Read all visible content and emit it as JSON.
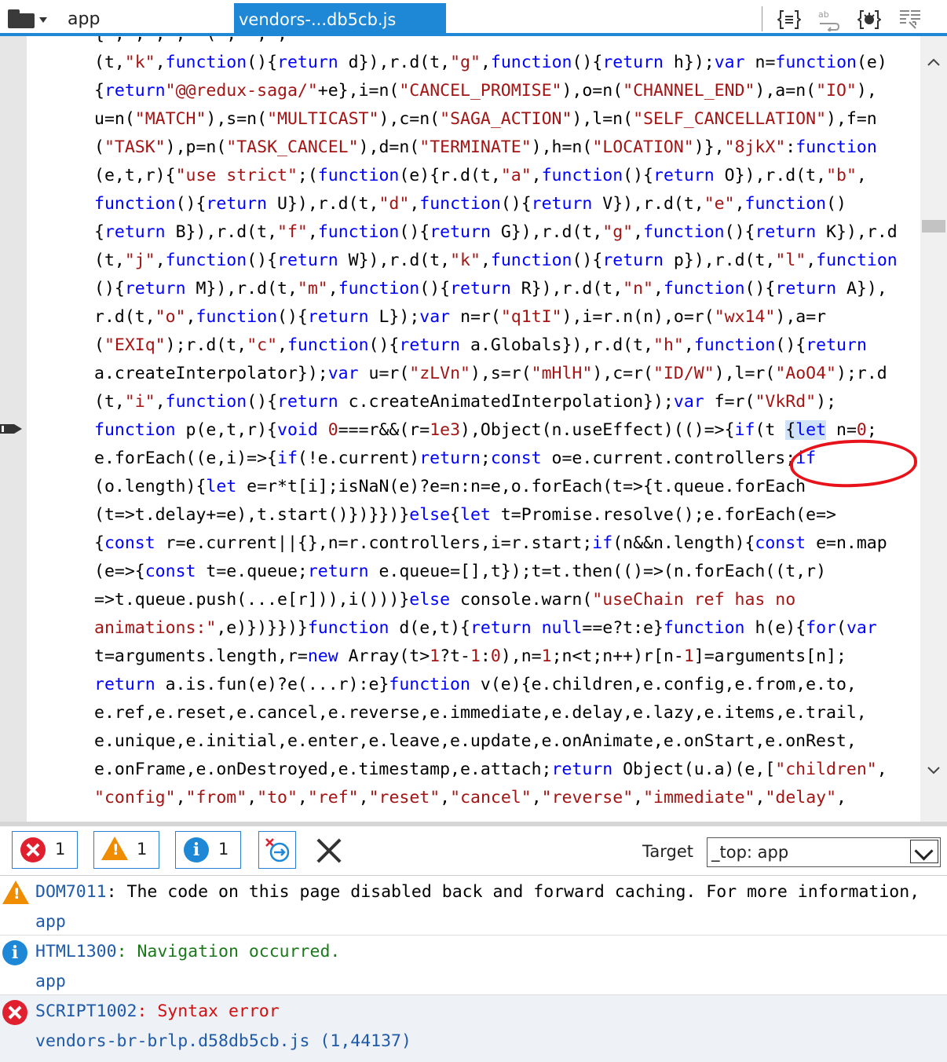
{
  "tabs": {
    "app_label": "app",
    "active_label": "vendors-...db5cb.js"
  },
  "editor": {
    "lines": [
      [
        [
          "p",
          "{ , , , ,  ( ,  , ;   "
        ]
      ],
      [
        [
          "p",
          "(t,"
        ],
        [
          "s",
          "\"k\""
        ],
        [
          "p",
          ","
        ],
        [
          "k",
          "function"
        ],
        [
          "p",
          "(){"
        ],
        [
          "k",
          "return"
        ],
        [
          "p",
          " d}),r.d(t,"
        ],
        [
          "s",
          "\"g\""
        ],
        [
          "p",
          ","
        ],
        [
          "k",
          "function"
        ],
        [
          "p",
          "(){"
        ],
        [
          "k",
          "return"
        ],
        [
          "p",
          " h});"
        ],
        [
          "k",
          "var"
        ],
        [
          "p",
          " n="
        ],
        [
          "k",
          "function"
        ],
        [
          "p",
          "(e)"
        ]
      ],
      [
        [
          "p",
          "{"
        ],
        [
          "k",
          "return"
        ],
        [
          "s",
          "\"@@redux-saga/\""
        ],
        [
          "p",
          "+e},i=n("
        ],
        [
          "s",
          "\"CANCEL_PROMISE\""
        ],
        [
          "p",
          "),o=n("
        ],
        [
          "s",
          "\"CHANNEL_END\""
        ],
        [
          "p",
          "),a=n("
        ],
        [
          "s",
          "\"IO\""
        ],
        [
          "p",
          "),"
        ]
      ],
      [
        [
          "p",
          "u=n("
        ],
        [
          "s",
          "\"MATCH\""
        ],
        [
          "p",
          "),s=n("
        ],
        [
          "s",
          "\"MULTICAST\""
        ],
        [
          "p",
          "),c=n("
        ],
        [
          "s",
          "\"SAGA_ACTION\""
        ],
        [
          "p",
          "),l=n("
        ],
        [
          "s",
          "\"SELF_CANCELLATION\""
        ],
        [
          "p",
          "),f=n"
        ]
      ],
      [
        [
          "p",
          "("
        ],
        [
          "s",
          "\"TASK\""
        ],
        [
          "p",
          "),p=n("
        ],
        [
          "s",
          "\"TASK_CANCEL\""
        ],
        [
          "p",
          "),d=n("
        ],
        [
          "s",
          "\"TERMINATE\""
        ],
        [
          "p",
          "),h=n("
        ],
        [
          "s",
          "\"LOCATION\""
        ],
        [
          "p",
          ")},"
        ],
        [
          "s",
          "\"8jkX\""
        ],
        [
          "p",
          ":"
        ],
        [
          "k",
          "function"
        ]
      ],
      [
        [
          "p",
          "(e,t,r){"
        ],
        [
          "s",
          "\"use strict\""
        ],
        [
          "p",
          ";("
        ],
        [
          "k",
          "function"
        ],
        [
          "p",
          "(e){r.d(t,"
        ],
        [
          "s",
          "\"a\""
        ],
        [
          "p",
          ","
        ],
        [
          "k",
          "function"
        ],
        [
          "p",
          "(){"
        ],
        [
          "k",
          "return"
        ],
        [
          "p",
          " O}),r.d(t,"
        ],
        [
          "s",
          "\"b\""
        ],
        [
          "p",
          ","
        ]
      ],
      [
        [
          "k",
          "function"
        ],
        [
          "p",
          "(){"
        ],
        [
          "k",
          "return"
        ],
        [
          "p",
          " U}),r.d(t,"
        ],
        [
          "s",
          "\"d\""
        ],
        [
          "p",
          ","
        ],
        [
          "k",
          "function"
        ],
        [
          "p",
          "(){"
        ],
        [
          "k",
          "return"
        ],
        [
          "p",
          " V}),r.d(t,"
        ],
        [
          "s",
          "\"e\""
        ],
        [
          "p",
          ","
        ],
        [
          "k",
          "function"
        ],
        [
          "p",
          "()"
        ]
      ],
      [
        [
          "p",
          "{"
        ],
        [
          "k",
          "return"
        ],
        [
          "p",
          " B}),r.d(t,"
        ],
        [
          "s",
          "\"f\""
        ],
        [
          "p",
          ","
        ],
        [
          "k",
          "function"
        ],
        [
          "p",
          "(){"
        ],
        [
          "k",
          "return"
        ],
        [
          "p",
          " G}),r.d(t,"
        ],
        [
          "s",
          "\"g\""
        ],
        [
          "p",
          ","
        ],
        [
          "k",
          "function"
        ],
        [
          "p",
          "(){"
        ],
        [
          "k",
          "return"
        ],
        [
          "p",
          " K}),r.d"
        ]
      ],
      [
        [
          "p",
          "(t,"
        ],
        [
          "s",
          "\"j\""
        ],
        [
          "p",
          ","
        ],
        [
          "k",
          "function"
        ],
        [
          "p",
          "(){"
        ],
        [
          "k",
          "return"
        ],
        [
          "p",
          " W}),r.d(t,"
        ],
        [
          "s",
          "\"k\""
        ],
        [
          "p",
          ","
        ],
        [
          "k",
          "function"
        ],
        [
          "p",
          "(){"
        ],
        [
          "k",
          "return"
        ],
        [
          "p",
          " p}),r.d(t,"
        ],
        [
          "s",
          "\"l\""
        ],
        [
          "p",
          ","
        ],
        [
          "k",
          "function"
        ]
      ],
      [
        [
          "p",
          "(){"
        ],
        [
          "k",
          "return"
        ],
        [
          "p",
          " M}),r.d(t,"
        ],
        [
          "s",
          "\"m\""
        ],
        [
          "p",
          ","
        ],
        [
          "k",
          "function"
        ],
        [
          "p",
          "(){"
        ],
        [
          "k",
          "return"
        ],
        [
          "p",
          " R}),r.d(t,"
        ],
        [
          "s",
          "\"n\""
        ],
        [
          "p",
          ","
        ],
        [
          "k",
          "function"
        ],
        [
          "p",
          "(){"
        ],
        [
          "k",
          "return"
        ],
        [
          "p",
          " A}),"
        ]
      ],
      [
        [
          "p",
          "r.d(t,"
        ],
        [
          "s",
          "\"o\""
        ],
        [
          "p",
          ","
        ],
        [
          "k",
          "function"
        ],
        [
          "p",
          "(){"
        ],
        [
          "k",
          "return"
        ],
        [
          "p",
          " L});"
        ],
        [
          "k",
          "var"
        ],
        [
          "p",
          " n=r("
        ],
        [
          "s",
          "\"q1tI\""
        ],
        [
          "p",
          "),i=r.n(n),o=r("
        ],
        [
          "s",
          "\"wx14\""
        ],
        [
          "p",
          "),a=r"
        ]
      ],
      [
        [
          "p",
          "("
        ],
        [
          "s",
          "\"EXIq\""
        ],
        [
          "p",
          ");r.d(t,"
        ],
        [
          "s",
          "\"c\""
        ],
        [
          "p",
          ","
        ],
        [
          "k",
          "function"
        ],
        [
          "p",
          "(){"
        ],
        [
          "k",
          "return"
        ],
        [
          "p",
          " a.Globals}),r.d(t,"
        ],
        [
          "s",
          "\"h\""
        ],
        [
          "p",
          ","
        ],
        [
          "k",
          "function"
        ],
        [
          "p",
          "(){"
        ],
        [
          "k",
          "return"
        ]
      ],
      [
        [
          "p",
          "a.createInterpolator});"
        ],
        [
          "k",
          "var"
        ],
        [
          "p",
          " u=r("
        ],
        [
          "s",
          "\"zLVn\""
        ],
        [
          "p",
          "),s=r("
        ],
        [
          "s",
          "\"mHlH\""
        ],
        [
          "p",
          "),c=r("
        ],
        [
          "s",
          "\"ID/W\""
        ],
        [
          "p",
          "),l=r("
        ],
        [
          "s",
          "\"AoO4\""
        ],
        [
          "p",
          ");r.d"
        ]
      ],
      [
        [
          "p",
          "(t,"
        ],
        [
          "s",
          "\"i\""
        ],
        [
          "p",
          ","
        ],
        [
          "k",
          "function"
        ],
        [
          "p",
          "(){"
        ],
        [
          "k",
          "return"
        ],
        [
          "p",
          " c.createAnimatedInterpolation});"
        ],
        [
          "k",
          "var"
        ],
        [
          "p",
          " f=r("
        ],
        [
          "s",
          "\"VkRd\""
        ],
        [
          "p",
          ");"
        ]
      ],
      [
        [
          "k",
          "function"
        ],
        [
          "p",
          " p(e,t,r){"
        ],
        [
          "k",
          "void"
        ],
        [
          "p",
          " "
        ],
        [
          "n",
          "0"
        ],
        [
          "p",
          "===r&&(r="
        ],
        [
          "n",
          "1e3"
        ],
        [
          "p",
          "),Object(n.useEffect)(()=>{"
        ],
        [
          "k",
          "if"
        ],
        [
          "p",
          "(t "
        ],
        [
          "sel",
          "{"
        ],
        [
          "ksel",
          "let"
        ],
        [
          "p",
          " n="
        ],
        [
          "n",
          "0"
        ],
        [
          "p",
          ";"
        ]
      ],
      [
        [
          "p",
          "e.forEach((e,i)=>{"
        ],
        [
          "k",
          "if"
        ],
        [
          "p",
          "(!e.current)"
        ],
        [
          "k",
          "return"
        ],
        [
          "p",
          ";"
        ],
        [
          "k",
          "const"
        ],
        [
          "p",
          " o=e.current.controllers;"
        ],
        [
          "k",
          "if"
        ]
      ],
      [
        [
          "p",
          "(o.length){"
        ],
        [
          "k",
          "let"
        ],
        [
          "p",
          " e=r*t[i];isNaN(e)?e=n:n=e,o.forEach(t=>{t.queue.forEach"
        ]
      ],
      [
        [
          "p",
          "(t=>t.delay+=e),t.start()})}})}"
        ],
        [
          "k",
          "else"
        ],
        [
          "p",
          "{"
        ],
        [
          "k",
          "let"
        ],
        [
          "p",
          " t=Promise.resolve();e.forEach(e=>"
        ]
      ],
      [
        [
          "p",
          "{"
        ],
        [
          "k",
          "const"
        ],
        [
          "p",
          " r=e.current||{},n=r.controllers,i=r.start;"
        ],
        [
          "k",
          "if"
        ],
        [
          "p",
          "(n&&n.length){"
        ],
        [
          "k",
          "const"
        ],
        [
          "p",
          " e=n.map"
        ]
      ],
      [
        [
          "p",
          "(e=>{"
        ],
        [
          "k",
          "const"
        ],
        [
          "p",
          " t=e.queue;"
        ],
        [
          "k",
          "return"
        ],
        [
          "p",
          " e.queue=[],t});t=t.then(()=>(n.forEach((t,r)"
        ]
      ],
      [
        [
          "p",
          "=>t.queue.push(...e[r])),i()))}"
        ],
        [
          "k",
          "else"
        ],
        [
          "p",
          " console.warn("
        ],
        [
          "s",
          "\"useChain ref has no"
        ]
      ],
      [
        [
          "s",
          "animations:\""
        ],
        [
          "p",
          ",e)})}})}"
        ],
        [
          "k",
          "function"
        ],
        [
          "p",
          " d(e,t){"
        ],
        [
          "k",
          "return"
        ],
        [
          "p",
          " "
        ],
        [
          "k",
          "null"
        ],
        [
          "p",
          "==e?t:e}"
        ],
        [
          "k",
          "function"
        ],
        [
          "p",
          " h(e){"
        ],
        [
          "k",
          "for"
        ],
        [
          "p",
          "("
        ],
        [
          "k",
          "var"
        ]
      ],
      [
        [
          "p",
          "t=arguments.length,r="
        ],
        [
          "k",
          "new"
        ],
        [
          "p",
          " Array(t>"
        ],
        [
          "n",
          "1"
        ],
        [
          "p",
          "?t-"
        ],
        [
          "n",
          "1"
        ],
        [
          "p",
          ":"
        ],
        [
          "n",
          "0"
        ],
        [
          "p",
          "),n="
        ],
        [
          "n",
          "1"
        ],
        [
          "p",
          ";n<t;n++)r[n-"
        ],
        [
          "n",
          "1"
        ],
        [
          "p",
          "]=arguments[n];"
        ]
      ],
      [
        [
          "k",
          "return"
        ],
        [
          "p",
          " a.is.fun(e)?e(...r):e}"
        ],
        [
          "k",
          "function"
        ],
        [
          "p",
          " v(e){e.children,e.config,e.from,e.to,"
        ]
      ],
      [
        [
          "p",
          "e.ref,e.reset,e.cancel,e.reverse,e.immediate,e.delay,e.lazy,e.items,e.trail,"
        ]
      ],
      [
        [
          "p",
          "e.unique,e.initial,e.enter,e.leave,e.update,e.onAnimate,e.onStart,e.onRest,"
        ]
      ],
      [
        [
          "p",
          "e.onFrame,e.onDestroyed,e.timestamp,e.attach;"
        ],
        [
          "k",
          "return"
        ],
        [
          "p",
          " Object(u.a)(e,["
        ],
        [
          "s",
          "\"children\""
        ],
        [
          "p",
          ","
        ]
      ],
      [
        [
          "s",
          "\"config\""
        ],
        [
          "p",
          ","
        ],
        [
          "s",
          "\"from\""
        ],
        [
          "p",
          ","
        ],
        [
          "s",
          "\"to\""
        ],
        [
          "p",
          ","
        ],
        [
          "s",
          "\"ref\""
        ],
        [
          "p",
          ","
        ],
        [
          "s",
          "\"reset\""
        ],
        [
          "p",
          ","
        ],
        [
          "s",
          "\"cancel\""
        ],
        [
          "p",
          ","
        ],
        [
          "s",
          "\"reverse\""
        ],
        [
          "p",
          ","
        ],
        [
          "s",
          "\"immediate\""
        ],
        [
          "p",
          ","
        ],
        [
          "s",
          "\"delay\""
        ],
        [
          "p",
          ","
        ]
      ]
    ]
  },
  "console": {
    "errors_count": "1",
    "warnings_count": "1",
    "info_count": "1",
    "target_label": "Target",
    "target_value": "_top: app",
    "messages": [
      {
        "type": "warning",
        "code": "DOM7011",
        "text": ": The code on this page disabled back and forward caching. For more information,",
        "source": "app"
      },
      {
        "type": "info",
        "code": "HTML1300",
        "text": ": Navigation occurred.",
        "source": "app"
      },
      {
        "type": "error",
        "code": "SCRIPT1002",
        "text": ": Syntax error",
        "source": "vendors-br-brlp.d58db5cb.js (1,44137)"
      }
    ]
  },
  "colors": {
    "accent": "#1e88d6",
    "error": "#e0202f",
    "warning": "#f08c00",
    "keyword": "#0000ff",
    "string": "#a31515",
    "annotation": "#e8121a"
  }
}
